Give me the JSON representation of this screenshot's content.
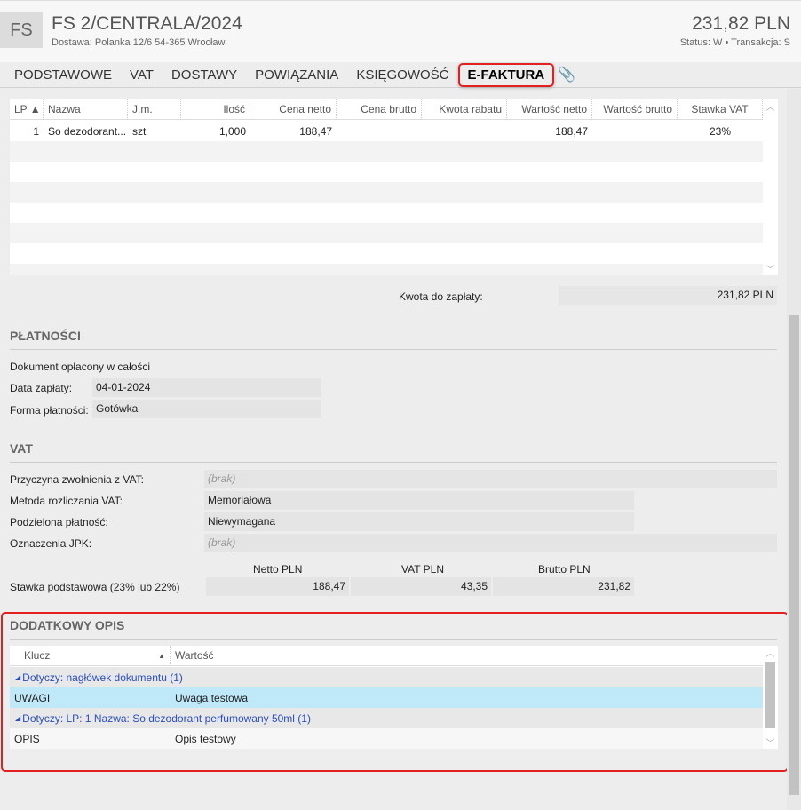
{
  "header": {
    "badge": "FS",
    "title": "FS 2/CENTRALA/2024",
    "delivery": "Dostawa: Polanka  12/6  54-365 Wrocław",
    "amount": "231,82 PLN",
    "status": "Status:  W  •  Transakcja:  S"
  },
  "tabs": [
    "PODSTAWOWE",
    "VAT",
    "DOSTAWY",
    "POWIĄZANIA",
    "KSIĘGOWOŚĆ",
    "E-FAKTURA"
  ],
  "items": {
    "columns": [
      "LP ▲",
      "Nazwa",
      "J.m.",
      "Ilość",
      "Cena netto",
      "Cena brutto",
      "Kwota rabatu",
      "Wartość netto",
      "Wartość brutto",
      "Stawka VAT"
    ],
    "rows": [
      [
        "1",
        "So dezodorant...",
        "szt",
        "1,000",
        "188,47",
        "",
        "",
        "188,47",
        "",
        "23%"
      ]
    ]
  },
  "total": {
    "label": "Kwota do zapłaty:",
    "value": "231,82 PLN"
  },
  "payments": {
    "title": "PŁATNOŚCI",
    "paid": "Dokument opłacony w całości",
    "date_label": "Data zapłaty:",
    "date": "04-01-2024",
    "form_label": "Forma płatności:",
    "form": "Gotówka"
  },
  "vat": {
    "title": "VAT",
    "reason_label": "Przyczyna zwolnienia z VAT:",
    "reason": "(brak)",
    "method_label": "Metoda rozliczania VAT:",
    "method": "Memoriałowa",
    "split_label": "Podzielona płatność:",
    "split": "Niewymagana",
    "jpk_label": "Oznaczenia JPK:",
    "jpk": "(brak)",
    "cols": [
      "Netto PLN",
      "VAT PLN",
      "Brutto PLN"
    ],
    "rate_label": "Stawka podstawowa (23% lub 22%)",
    "netto": "188,47",
    "vat": "43,35",
    "brutto": "231,82"
  },
  "opis": {
    "title": "DODATKOWY OPIS",
    "col_key": "Klucz",
    "col_value": "Wartość",
    "groups": [
      {
        "label": "Dotyczy: nagłówek dokumentu (1)",
        "key": "UWAGI",
        "value": "Uwaga testowa"
      },
      {
        "label": "Dotyczy: LP: 1 Nazwa: So dezodorant perfumowany 50ml (1)",
        "key": "OPIS",
        "value": "Opis testowy"
      }
    ]
  }
}
